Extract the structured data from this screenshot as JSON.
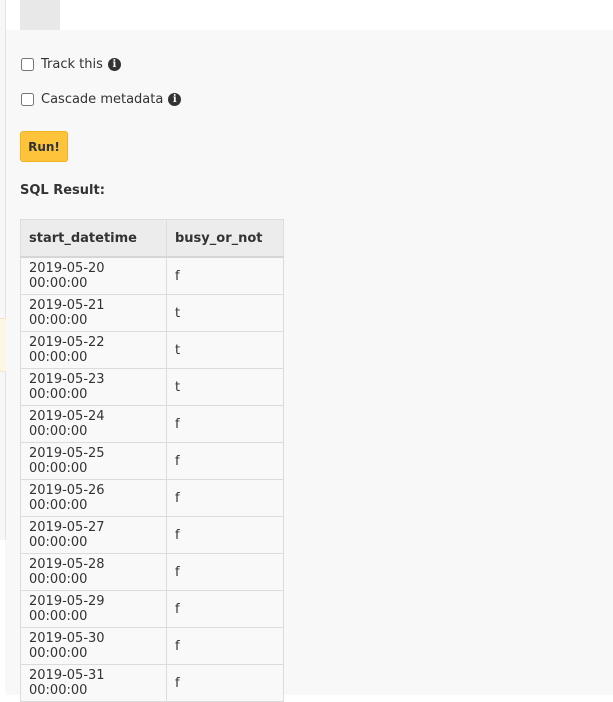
{
  "options": {
    "track_label": "Track this",
    "cascade_label": "Cascade metadata"
  },
  "run_button": "Run!",
  "result_title": "SQL Result:",
  "table": {
    "headers": [
      "start_datetime",
      "busy_or_not"
    ],
    "rows": [
      [
        "2019-05-20 00:00:00",
        "f"
      ],
      [
        "2019-05-21 00:00:00",
        "t"
      ],
      [
        "2019-05-22 00:00:00",
        "t"
      ],
      [
        "2019-05-23 00:00:00",
        "t"
      ],
      [
        "2019-05-24 00:00:00",
        "f"
      ],
      [
        "2019-05-25 00:00:00",
        "f"
      ],
      [
        "2019-05-26 00:00:00",
        "f"
      ],
      [
        "2019-05-27 00:00:00",
        "f"
      ],
      [
        "2019-05-28 00:00:00",
        "f"
      ],
      [
        "2019-05-29 00:00:00",
        "f"
      ],
      [
        "2019-05-30 00:00:00",
        "f"
      ],
      [
        "2019-05-31 00:00:00",
        "f"
      ]
    ]
  },
  "icons": {
    "info": "info-circle-icon"
  },
  "colors": {
    "run_button": "#fdc43b",
    "panel_bg": "#f8f8f8"
  }
}
